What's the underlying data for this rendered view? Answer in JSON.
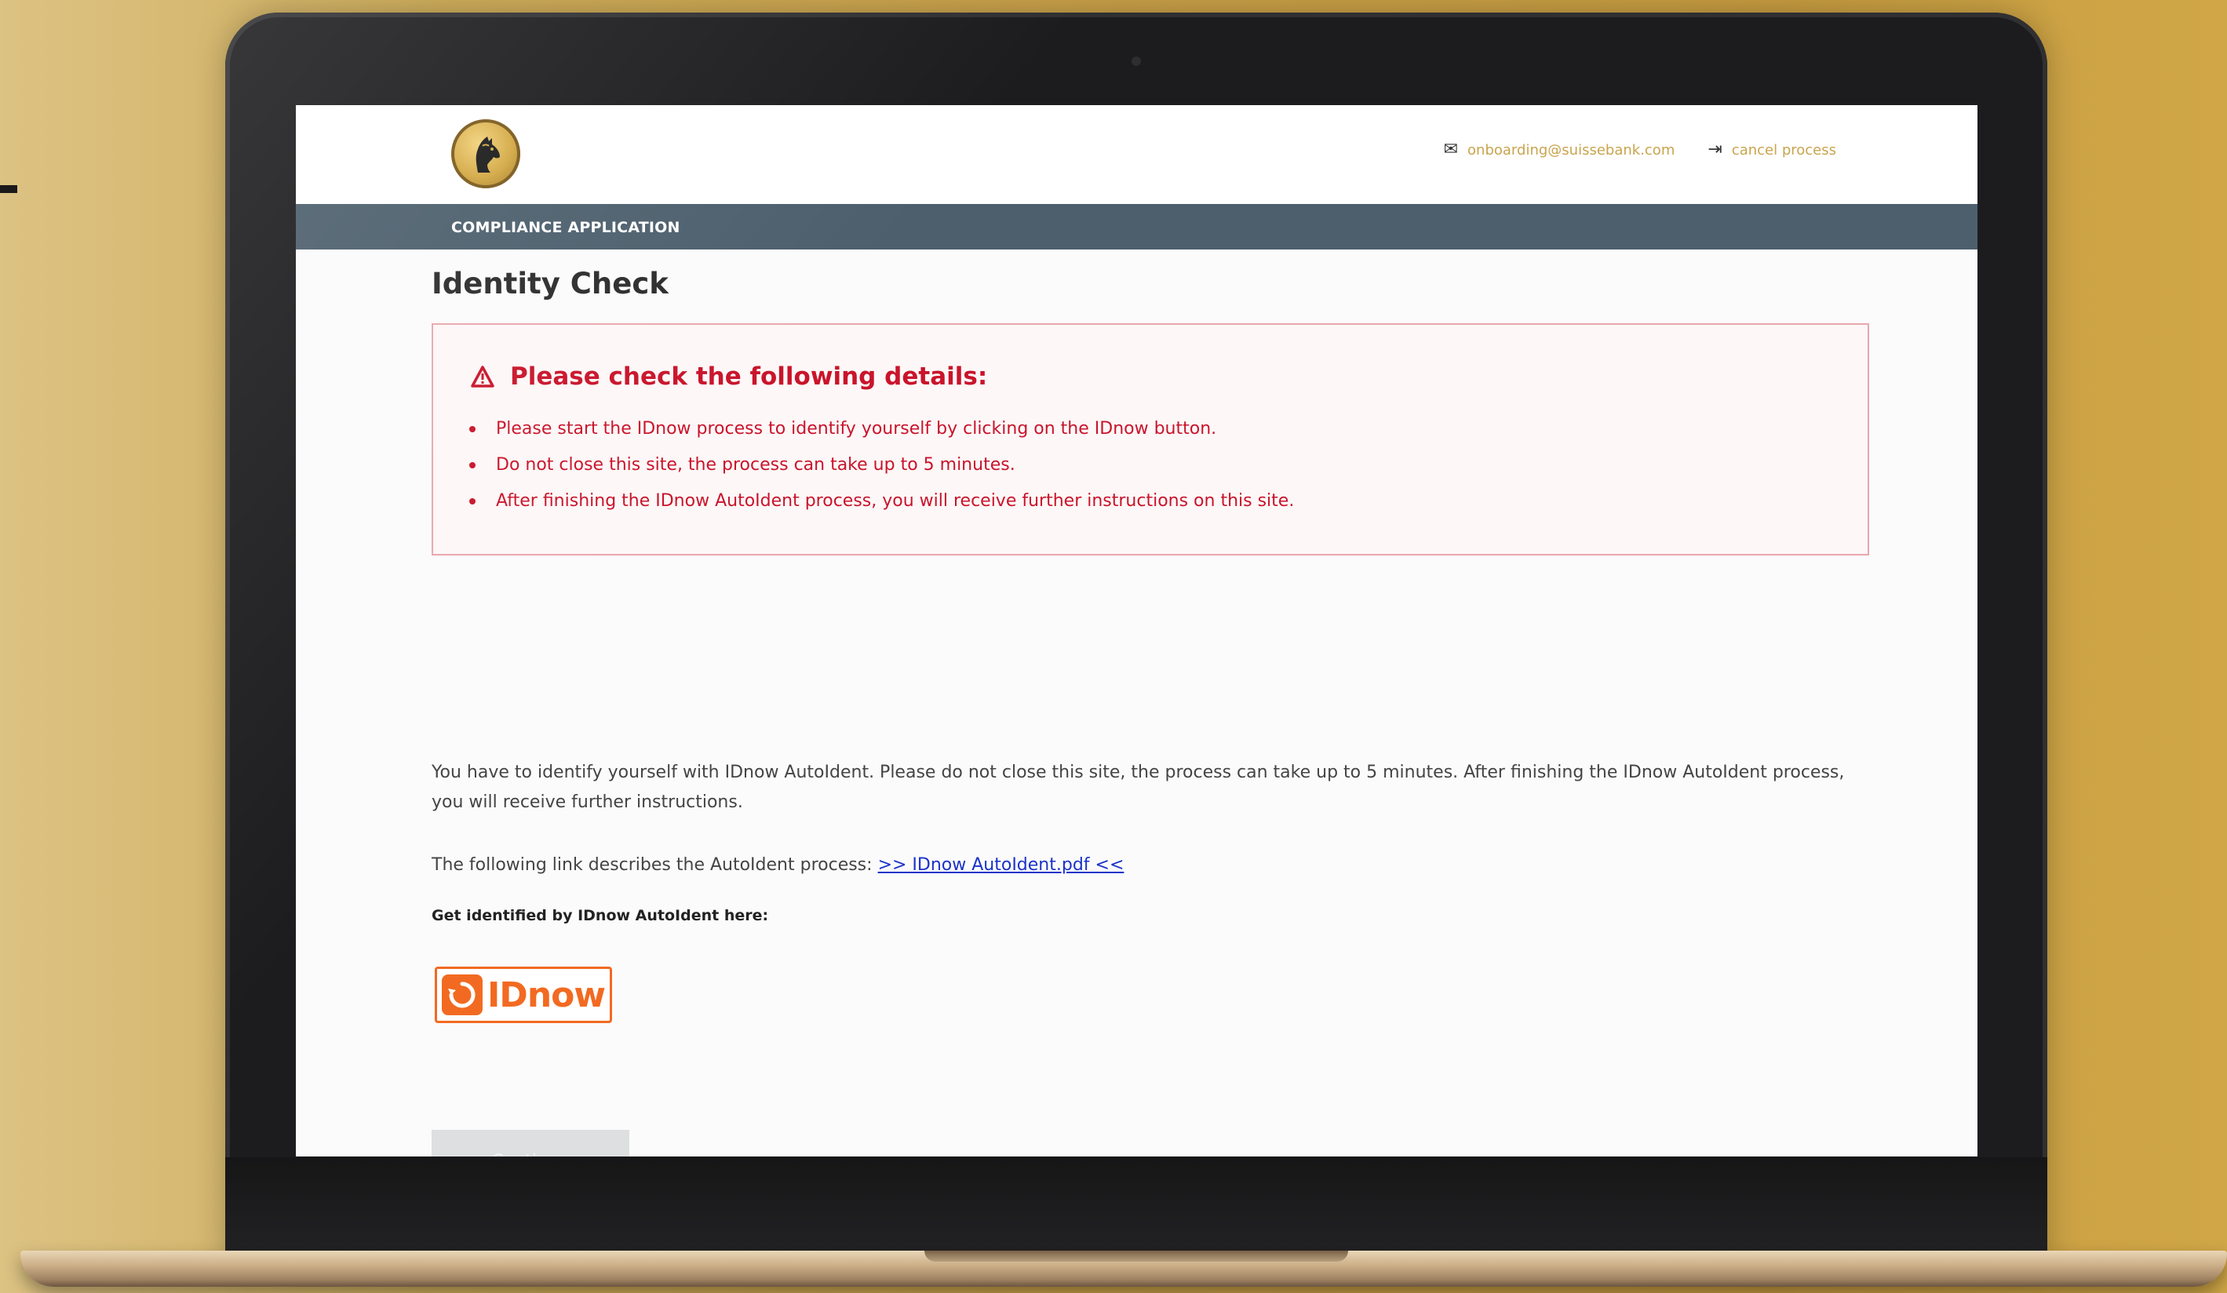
{
  "header": {
    "email_link": "onboarding@suissebank.com",
    "cancel_link": "cancel process"
  },
  "navbar": {
    "label": "COMPLIANCE APPLICATION"
  },
  "page": {
    "title": "Identity Check"
  },
  "alert": {
    "heading": "Please check the following details:",
    "items": [
      "Please start the IDnow process to identify yourself by clicking on the IDnow button.",
      "Do not close this site, the process can take up to 5 minutes.",
      "After finishing the IDnow AutoIdent process, you will receive further instructions on this site."
    ]
  },
  "body": {
    "intro": "You have to identify yourself with IDnow AutoIdent. Please do not close this site, the process can take up to 5 minutes. After finishing the IDnow AutoIdent process, you will receive further instructions.",
    "link_prefix": "The following link describes the AutoIdent process: ",
    "link_text": ">> IDnow AutoIdent.pdf <<",
    "get_identified_label": "Get identified by IDnow AutoIdent here:",
    "idnow_button_text": "IDnow",
    "continue_button": "Continue"
  },
  "colors": {
    "navbar": "#4d5f6d",
    "alert_red": "#c9142b",
    "gold_link": "#c9a44d",
    "idnow_orange": "#f26a21"
  },
  "icons": [
    "horse-logo",
    "mail-icon",
    "sign-out-icon",
    "warning-icon",
    "idnow-logo-icon"
  ]
}
